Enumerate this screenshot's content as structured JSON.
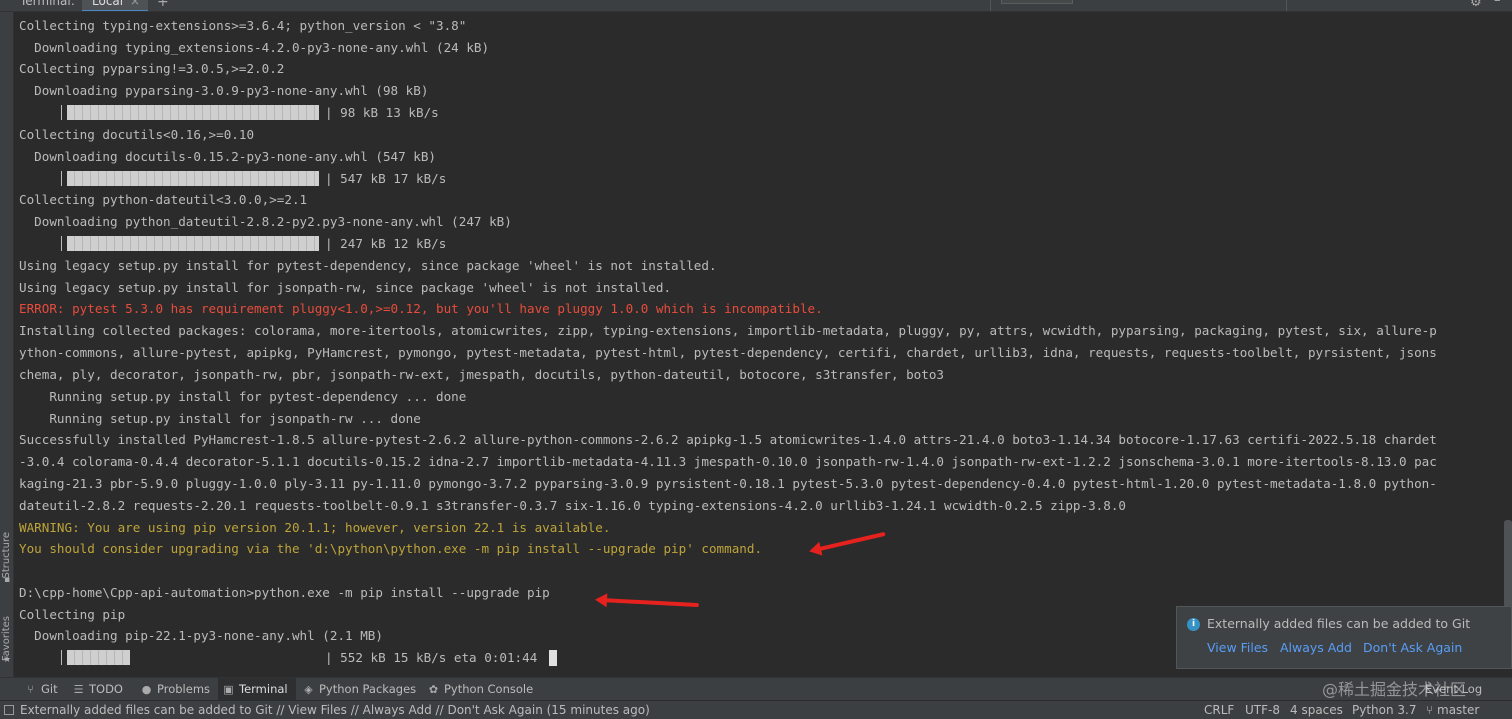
{
  "tabbar": {
    "label": "Terminal:",
    "tab": "Local",
    "close": "×",
    "add": "+"
  },
  "sidebar": {
    "structure": "Structure",
    "favorites": "Favorites"
  },
  "terminal": {
    "lines": [
      "Collecting typing-extensions>=3.6.4; python_version < \"3.8\"",
      "  Downloading typing_extensions-4.2.0-py3-none-any.whl (24 kB)",
      "Collecting pyparsing!=3.0.5,>=2.0.2",
      "  Downloading pyparsing-3.0.9-py3-none-any.whl (98 kB)",
      "Collecting docutils<0.16,>=0.10",
      "  Downloading docutils-0.15.2-py3-none-any.whl (547 kB)",
      "Collecting python-dateutil<3.0.0,>=2.1",
      "  Downloading python_dateutil-2.8.2-py2.py3-none-any.whl (247 kB)",
      "Using legacy setup.py install for pytest-dependency, since package 'wheel' is not installed.",
      "Using legacy setup.py install for jsonpath-rw, since package 'wheel' is not installed.",
      "ERROR: pytest 5.3.0 has requirement pluggy<1.0,>=0.12, but you'll have pluggy 1.0.0 which is incompatible.",
      "Installing collected packages: colorama, more-itertools, atomicwrites, zipp, typing-extensions, importlib-metadata, pluggy, py, attrs, wcwidth, pyparsing, packaging, pytest, six, allure-p",
      "ython-commons, allure-pytest, apipkg, PyHamcrest, pymongo, pytest-metadata, pytest-html, pytest-dependency, certifi, chardet, urllib3, idna, requests, requests-toolbelt, pyrsistent, jsons",
      "chema, ply, decorator, jsonpath-rw, pbr, jsonpath-rw-ext, jmespath, docutils, python-dateutil, botocore, s3transfer, boto3",
      "    Running setup.py install for pytest-dependency ... done",
      "    Running setup.py install for jsonpath-rw ... done",
      "Successfully installed PyHamcrest-1.8.5 allure-pytest-2.6.2 allure-python-commons-2.6.2 apipkg-1.5 atomicwrites-1.4.0 attrs-21.4.0 boto3-1.14.34 botocore-1.17.63 certifi-2022.5.18 chardet",
      "-3.0.4 colorama-0.4.4 decorator-5.1.1 docutils-0.15.2 idna-2.7 importlib-metadata-4.11.3 jmespath-0.10.0 jsonpath-rw-1.4.0 jsonpath-rw-ext-1.2.2 jsonschema-3.0.1 more-itertools-8.13.0 pac",
      "kaging-21.3 pbr-5.9.0 pluggy-1.0.0 ply-3.11 py-1.11.0 pymongo-3.7.2 pyparsing-3.0.9 pyrsistent-0.18.1 pytest-5.3.0 pytest-dependency-0.4.0 pytest-html-1.20.0 pytest-metadata-1.8.0 python-",
      "dateutil-2.8.2 requests-2.20.1 requests-toolbelt-0.9.1 s3transfer-0.3.7 six-1.16.0 typing-extensions-4.2.0 urllib3-1.24.1 wcwidth-0.2.5 zipp-3.8.0",
      "WARNING: You are using pip version 20.1.1; however, version 22.1 is available.",
      "You should consider upgrading via the 'd:\\python\\python.exe -m pip install --upgrade pip' command.",
      "D:\\cpp-home\\Cpp-api-automation>python.exe -m pip install --upgrade pip",
      "Collecting pip",
      "  Downloading pip-22.1-py3-none-any.whl (2.1 MB)"
    ],
    "progress": [
      {
        "fraction": 1.0,
        "text": "| 98 kB 13 kB/s"
      },
      {
        "fraction": 1.0,
        "text": "| 547 kB 17 kB/s"
      },
      {
        "fraction": 1.0,
        "text": "| 247 kB 12 kB/s"
      },
      {
        "fraction": 0.25,
        "text": "| 552 kB 15 kB/s eta 0:01:44"
      }
    ]
  },
  "notification": {
    "title": "Externally added files can be added to Git",
    "actions": [
      "View Files",
      "Always Add",
      "Don't Ask Again"
    ]
  },
  "toolwindows": {
    "git": "Git",
    "todo": "TODO",
    "problems": "Problems",
    "terminal": "Terminal",
    "python_packages": "Python Packages",
    "python_console": "Python Console",
    "event_log": "Event Log"
  },
  "statusbar": {
    "message": "Externally added files can be added to Git // View Files // Always Add // Don't Ask Again (15 minutes ago)",
    "line_sep": "CRLF",
    "encoding": "UTF-8",
    "indent": "4 spaces",
    "interpreter": "Python 3.7",
    "branch": "master"
  },
  "watermark": "@稀土掘金技术社区"
}
